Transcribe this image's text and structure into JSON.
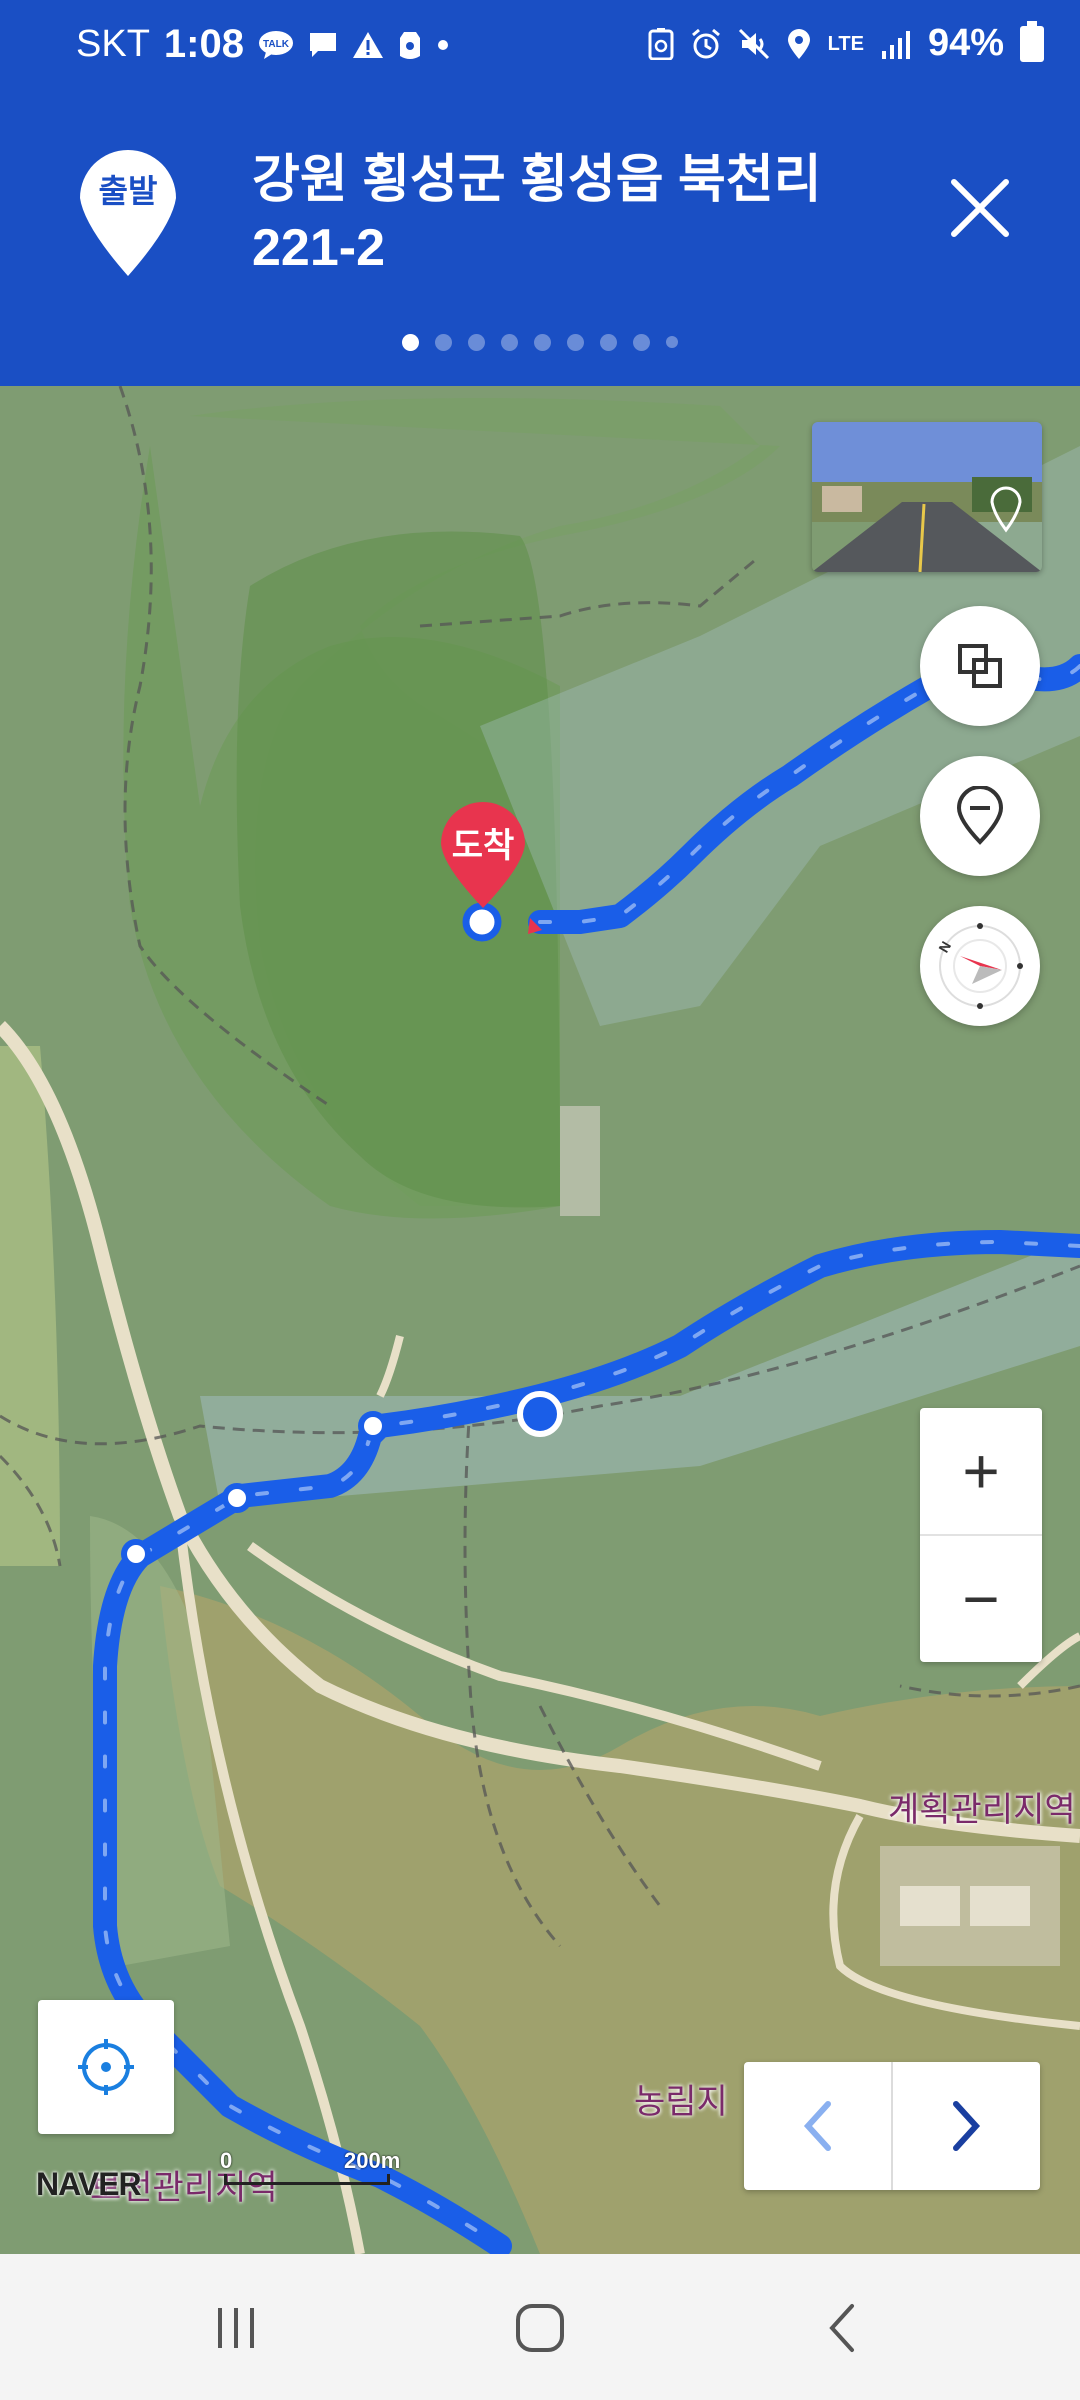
{
  "status_bar": {
    "carrier": "SKT",
    "time": "1:08",
    "battery": "94%",
    "network": "LTE"
  },
  "header": {
    "start_badge": "출발",
    "title_line1": "강원 횡성군 횡성읍 북천리",
    "title_line2": "221-2",
    "page_count": 9,
    "active_page": 1
  },
  "map": {
    "destination_badge": "도착",
    "labels": {
      "planned_area": "계획관리지역",
      "forest_area": "농림지",
      "bottom_area": "보전관리지역"
    },
    "logo": "NAVER",
    "scale": {
      "start": "0",
      "end": "200m"
    },
    "zoom_in": "+",
    "zoom_out": "−"
  },
  "colors": {
    "brand_blue": "#1a4fc4",
    "route_blue": "#1a5ee8",
    "destination_red": "#e8344e"
  }
}
